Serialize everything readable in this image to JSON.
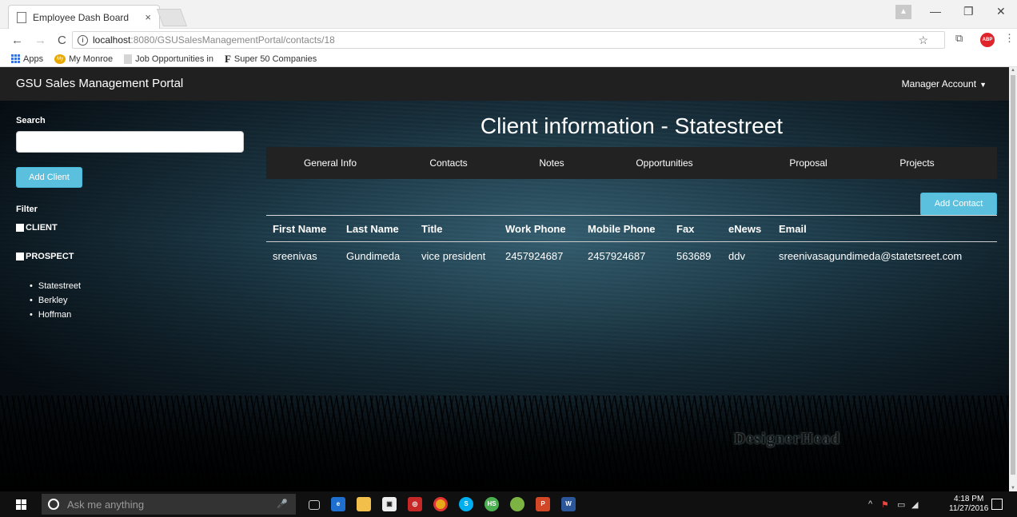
{
  "browser": {
    "tab_title": "Employee Dash Board",
    "tab_close": "×",
    "url_host": "localhost",
    "url_path": ":8080/GSUSalesManagementPortal/contacts/18",
    "bookmarks": [
      {
        "label": "Apps"
      },
      {
        "label": "My Monroe"
      },
      {
        "label": "Job Opportunities in"
      },
      {
        "label": "Super 50 Companies"
      }
    ],
    "abp_label": "ABP"
  },
  "header": {
    "brand": "GSU Sales Management Portal",
    "account_menu": "Manager Account"
  },
  "sidebar": {
    "search_label": "Search",
    "search_value": "",
    "add_client_label": "Add Client",
    "filter_label": "Filter",
    "filters": [
      {
        "label": "CLIENT"
      },
      {
        "label": "PROSPECT"
      }
    ],
    "clients": [
      "Statestreet",
      "Berkley",
      "Hoffman"
    ]
  },
  "main": {
    "title": "Client information - Statestreet",
    "tabs": [
      {
        "label": "General Info"
      },
      {
        "label": "Contacts"
      },
      {
        "label": "Notes"
      },
      {
        "label": "Opportunities"
      },
      {
        "label": "Proposal"
      },
      {
        "label": "Projects"
      }
    ],
    "active_tab": "Contacts",
    "add_contact_label": "Add Contact",
    "table": {
      "columns": [
        "First Name",
        "Last Name",
        "Title",
        "Work Phone",
        "Mobile Phone",
        "Fax",
        "eNews",
        "Email"
      ],
      "rows": [
        [
          "sreenivas",
          "Gundimeda",
          "vice president",
          "2457924687",
          "2457924687",
          "563689",
          "ddv",
          "sreenivasagundimeda@statetsreet.com"
        ]
      ]
    },
    "watermark": "DesignerHead"
  },
  "taskbar": {
    "search_placeholder": "Ask me anything",
    "time": "4:18 PM",
    "date": "11/27/2016"
  },
  "colors": {
    "navbar": "#202020",
    "accent_button": "#5bc0de",
    "tabs_bg": "#222222"
  }
}
